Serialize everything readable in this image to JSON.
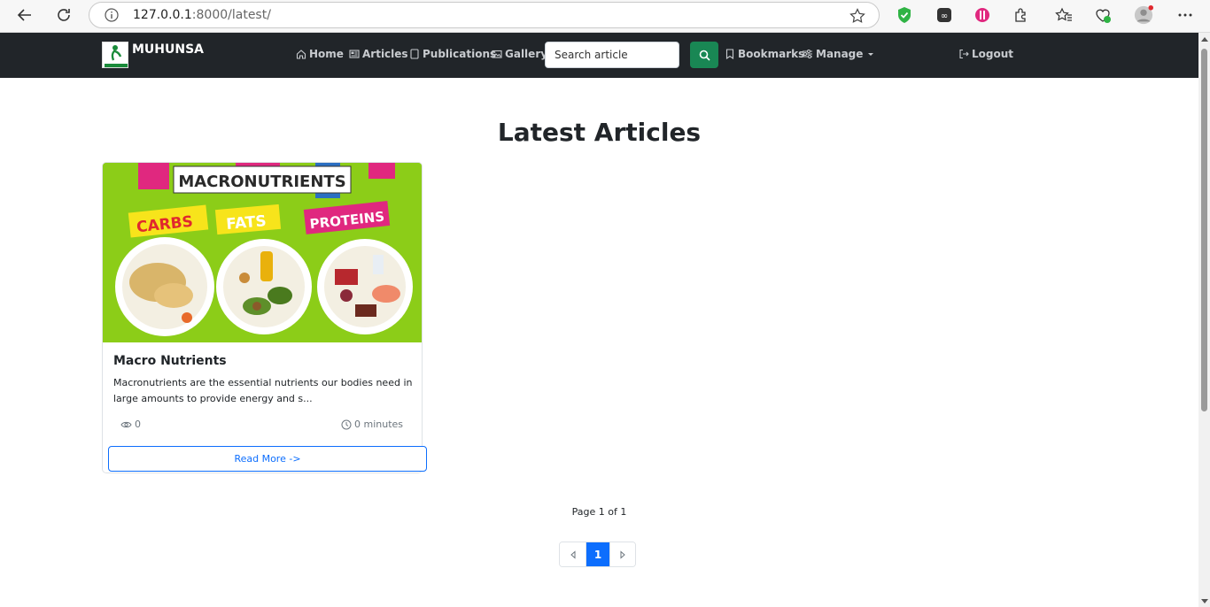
{
  "browser": {
    "url_host": "127.0.0.1",
    "url_rest": ":8000/latest/"
  },
  "navbar": {
    "brand": "MUHUNSA",
    "links": {
      "home": "Home",
      "articles": "Articles",
      "publications": "Publications",
      "gallery": "Gallery",
      "bookmarks": "Bookmarks",
      "manage": "Manage",
      "logout": "Logout"
    },
    "search_placeholder": "Search article",
    "search_color": "#198754"
  },
  "main": {
    "heading": "Latest Articles",
    "articles": [
      {
        "image_text": {
          "banner": "MACRONUTRIENTS",
          "carbs": "CARBS",
          "fats": "FATS",
          "proteins": "PROTEINS"
        },
        "title": "Macro Nutrients",
        "excerpt": "Macronutrients are the essential nutrients our bodies need in large amounts to provide energy and s...",
        "views": "0",
        "read_time": "0 minutes",
        "read_more": "Read More ->"
      }
    ],
    "pagination": {
      "info": "Page 1 of 1",
      "current": "1"
    }
  }
}
